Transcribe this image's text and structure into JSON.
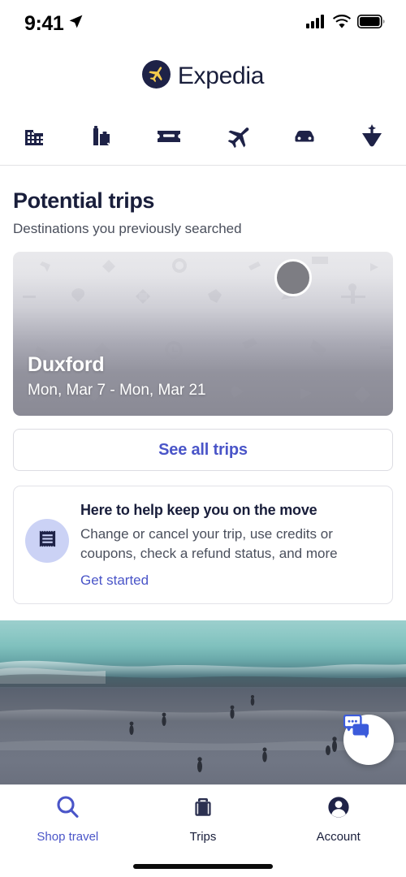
{
  "status_bar": {
    "time": "9:41",
    "location_icon": "location-arrow-icon",
    "signal_icon": "cellular-signal-icon",
    "wifi_icon": "wifi-icon",
    "battery_icon": "battery-full-icon"
  },
  "header": {
    "brand": "Expedia",
    "logo_icon": "expedia-plane-logo-icon",
    "logo_circle_color": "#1e2247",
    "logo_plane_color": "#f2c94c",
    "brand_text_color": "#191e3b"
  },
  "categories": [
    {
      "name": "hotel-icon",
      "label": "Stays"
    },
    {
      "name": "packages-icon",
      "label": "Packages"
    },
    {
      "name": "ticket-icon",
      "label": "Things to do"
    },
    {
      "name": "flight-icon",
      "label": "Flights"
    },
    {
      "name": "car-icon",
      "label": "Cars"
    },
    {
      "name": "cruise-icon",
      "label": "Cruises"
    }
  ],
  "main": {
    "title": "Potential trips",
    "subtitle": "Destinations you previously searched",
    "trip_card": {
      "destination": "Duxford",
      "dates": "Mon, Mar 7 - Mon, Mar 21",
      "avatar_icon": "trip-avatar-circle"
    },
    "see_all_trips": "See all trips",
    "help_card": {
      "icon": "receipt-icon",
      "title": "Here to help keep you on the move",
      "description": "Change or cancel your trip, use credits or coupons, check a refund status, and more",
      "link": "Get started"
    },
    "photo": {
      "alt": "beach-ocean-photo",
      "chat_button_icon": "chat-bubbles-icon"
    }
  },
  "tab_bar": [
    {
      "icon": "search-icon",
      "label": "Shop travel",
      "active": true
    },
    {
      "icon": "suitcase-icon",
      "label": "Trips",
      "active": false
    },
    {
      "icon": "account-icon",
      "label": "Account",
      "active": false
    }
  ],
  "colors": {
    "accent_blue": "#4a55c8",
    "navy": "#191e3b",
    "muted_text": "#4a4f5c",
    "icon_bg_lavender": "#cbd2f5",
    "border": "#e2e2e8"
  }
}
